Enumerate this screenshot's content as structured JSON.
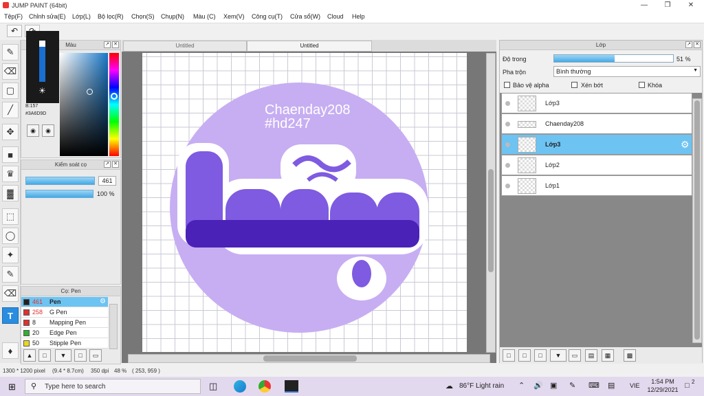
{
  "window": {
    "title": "JUMP PAINT (64bit)",
    "minimize": "—",
    "maximize": "❐",
    "close": "✕"
  },
  "menu": [
    "Tệp(F)",
    "Chỉnh sửa(E)",
    "Lớp(L)",
    "Bộ lọc(R)",
    "Chọn(S)",
    "Chụp(N)",
    "Màu (C)",
    "Xem(V)",
    "Công cụ(T)",
    "Cửa sổ(W)",
    "Cloud",
    "Help"
  ],
  "color_panel": {
    "title": "Màu",
    "rgb_label": "B:157",
    "hex": "#3A6D9D"
  },
  "brush_control": {
    "title": "Kiểm soát cọ",
    "size_value": "461",
    "opacity_value": "100 %"
  },
  "brush_panel": {
    "title": "Cọ: Pen",
    "items": [
      {
        "size": "461",
        "name": "Pen",
        "color": "#222222"
      },
      {
        "size": "258",
        "name": "G Pen",
        "color": "#e03030"
      },
      {
        "size": "8",
        "name": "Mapping Pen",
        "color": "#e03030"
      },
      {
        "size": "20",
        "name": "Edge Pen",
        "color": "#30b030"
      },
      {
        "size": "50",
        "name": "Stipple Pen",
        "color": "#e8d820"
      }
    ]
  },
  "tabs": [
    "Untitled",
    "Untitled"
  ],
  "canvas": {
    "text1": "Chaenday208",
    "text2": "#hd247",
    "text_color": "#ffffff",
    "circle_color": "#c7aef2"
  },
  "layer_panel": {
    "title": "Lớp",
    "opacity_label": "Độ trong",
    "opacity_value": "51 %",
    "opacity_fraction": 0.51,
    "blend_label": "Pha trộn",
    "blend_value": "Bình thường",
    "protect_alpha": "Bảo vệ alpha",
    "clip": "Xén bớt",
    "lock": "Khóa",
    "layers": [
      "Lớp3",
      "Chaenday208",
      "Lớp3",
      "Lớp2",
      "Lớp1"
    ]
  },
  "status": {
    "size": "1300 * 1200 pixel",
    "cm": "(9.4 * 8.7cm)",
    "dpi": "350 dpi",
    "zoom": "48 %",
    "coords": "( 253, 959 )"
  },
  "taskbar": {
    "search_placeholder": "Type here to search",
    "weather": "86°F  Light rain",
    "lang": "VIE",
    "time": "1:54 PM",
    "date": "12/29/2021",
    "notif": "2"
  },
  "colors": {
    "accent": "#6dc3f2",
    "tool_active": "#2a8de0",
    "purple_light": "#c7aef2",
    "purple_dark": "#5a2ec8"
  }
}
